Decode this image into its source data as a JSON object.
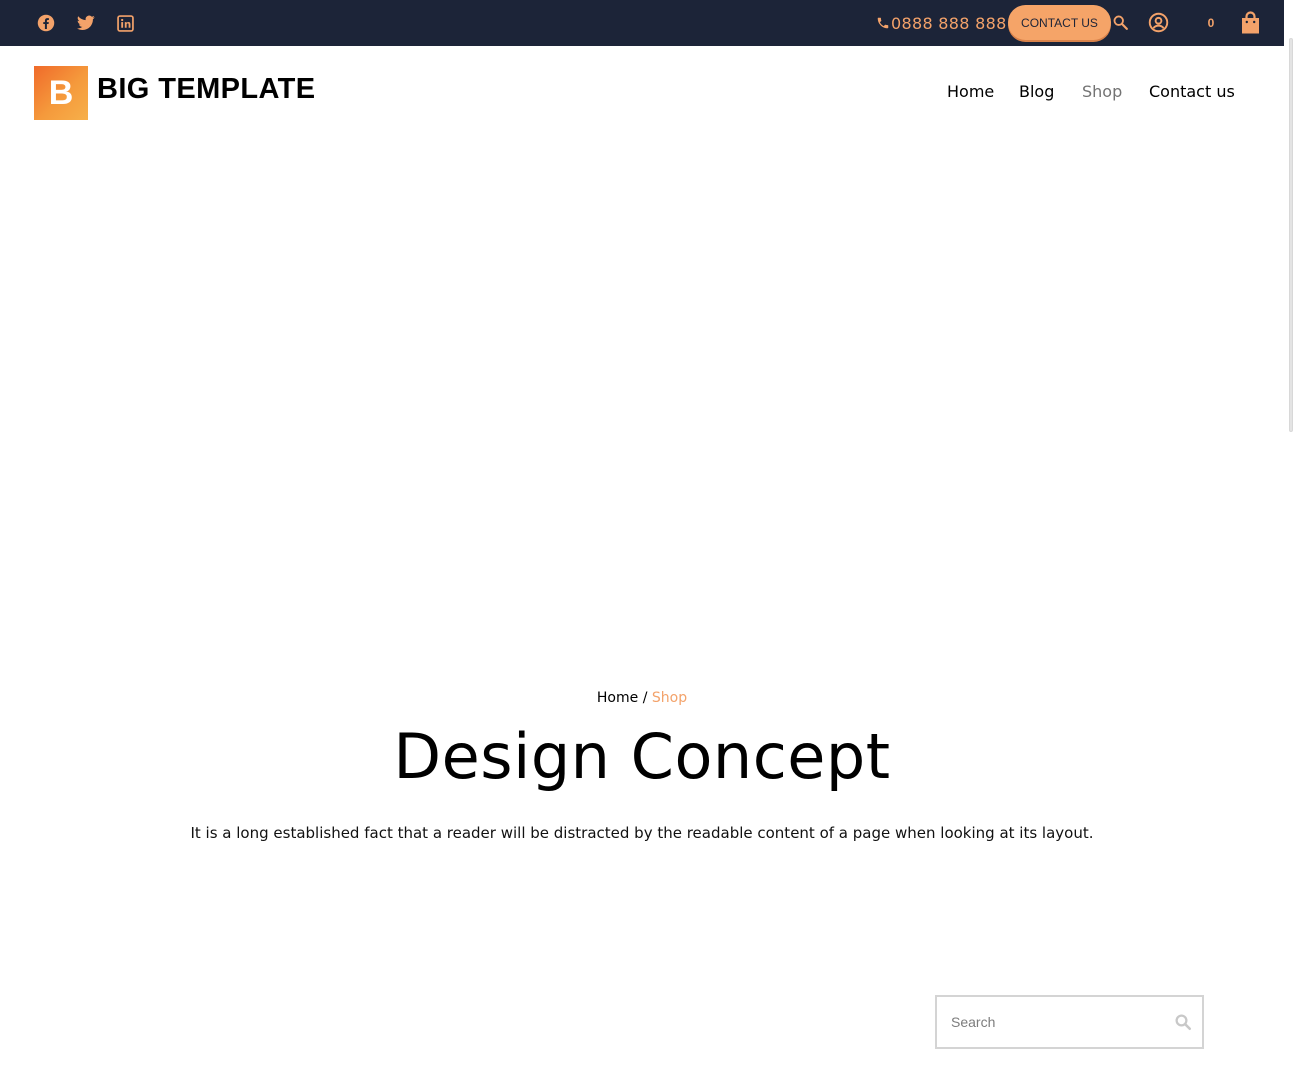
{
  "topbar": {
    "social_icons": [
      "facebook-icon",
      "twitter-icon",
      "linkedin-icon"
    ],
    "phone": "0888 888 888",
    "contact_button": "CONTACT US",
    "cart_count": "0",
    "icons": [
      "phone-icon",
      "search-icon",
      "user-account-icon",
      "shopping-bag-icon"
    ]
  },
  "header": {
    "logo_letter": "B",
    "logo_text": "BIG TEMPLATE",
    "nav": [
      {
        "label": "Home"
      },
      {
        "label": "Blog"
      },
      {
        "label": "Shop",
        "active": true
      },
      {
        "label": "Contact us"
      }
    ]
  },
  "hero": {
    "breadcrumb_home": "Home",
    "breadcrumb_separator": "/",
    "breadcrumb_current": "Shop",
    "title": "Design Concept",
    "lead": "It is a long established fact that a reader will be distracted by the readable content of a page when looking at its layout."
  },
  "sidebar_search": {
    "placeholder": "Search",
    "value": ""
  },
  "colors": {
    "topbar_bg": "#1c2438",
    "accent": "#f3a26a",
    "logo_gradient_start": "#f06a2a",
    "logo_gradient_end": "#f7b04a",
    "nav_active": "#737373"
  }
}
